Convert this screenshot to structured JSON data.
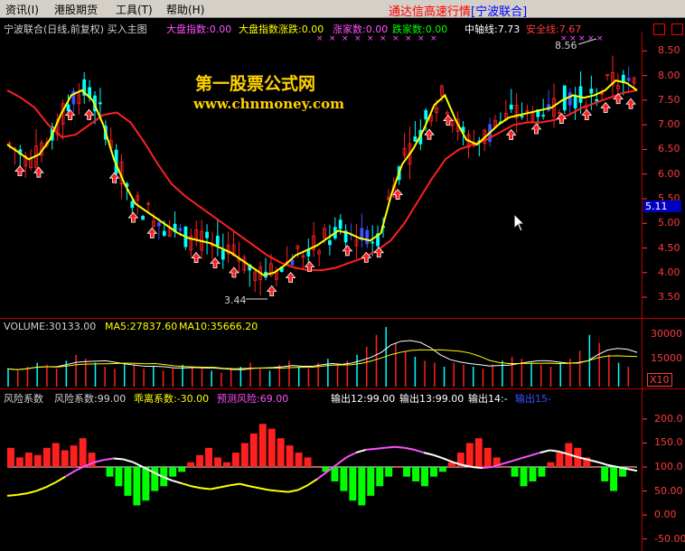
{
  "menu": {
    "items": [
      "资讯(I)",
      "港股期货",
      "工具(T)",
      "帮助(H)"
    ],
    "app_title": "通达信高速行情",
    "app_subtitle": "[宁波联合]"
  },
  "header": {
    "title": "宁波联合(日线,前复权) 买入主图",
    "dp_label": "大盘指数:0.00",
    "dpzd_label": "大盘指数涨跌:0.00",
    "zj_label": "涨家数:0.00",
    "dj_label": "跌家数:0.00",
    "zz_label": "中轴线:7.73",
    "aq_label": "安全线:7.67"
  },
  "watermark": {
    "line1": "第一股票公式网",
    "line2": "www.chnmoney.com"
  },
  "price_panel": {
    "high_label": "8.56",
    "low_label": "3.44",
    "current_price": "5.11",
    "ticks": [
      "8.50",
      "8.00",
      "7.50",
      "7.00",
      "6.50",
      "6.00",
      "5.50",
      "5.00",
      "4.50",
      "4.00",
      "3.50"
    ]
  },
  "volume_panel": {
    "label": "VOLUME:30133.00",
    "ma5_label": "MA5:27837.60",
    "ma10_label": "MA10:35666.20",
    "ticks": [
      "30000",
      "15000"
    ],
    "unit": "X10"
  },
  "risk_panel": {
    "title": "风险系数",
    "fx_label": "风险系数:99.00",
    "gl_label": "乖离系数:-30.00",
    "yc_label": "预测风险:69.00",
    "o12_label": "输出12:99.00",
    "o13_label": "输出13:99.00",
    "o14_label": "输出14:-",
    "o15_label": "输出15-",
    "ticks": [
      "200.0",
      "150.0",
      "100.0",
      "50.00",
      "0.00",
      "-50.00"
    ]
  },
  "colors": {
    "yellow": "#ffff00",
    "red": "#ff2020",
    "cyan": "#00ffff",
    "green": "#00ff00",
    "magenta": "#ff50ff",
    "white": "#ffffff",
    "axis_red": "#ff3b3b",
    "blue": "#3c50ff"
  },
  "chart_data": {
    "type": "line",
    "ylim": [
      3.3,
      8.8
    ],
    "ma_yellow": [
      6.6,
      6.45,
      6.3,
      6.4,
      6.7,
      7.2,
      7.6,
      7.7,
      7.5,
      7.0,
      6.3,
      5.8,
      5.4,
      5.25,
      5.1,
      4.95,
      4.8,
      4.7,
      4.65,
      4.6,
      4.5,
      4.4,
      4.25,
      4.1,
      3.95,
      4.0,
      4.15,
      4.35,
      4.45,
      4.55,
      4.7,
      4.85,
      4.8,
      4.7,
      4.65,
      4.8,
      5.6,
      6.2,
      6.5,
      6.9,
      7.4,
      7.6,
      7.1,
      6.7,
      6.6,
      6.8,
      7.0,
      7.15,
      7.2,
      7.25,
      7.3,
      7.35,
      7.5,
      7.6,
      7.55,
      7.6,
      7.7,
      7.9,
      7.85,
      7.7
    ],
    "ma_red": [
      7.7,
      7.55,
      7.35,
      7.0,
      6.75,
      6.8,
      7.0,
      7.2,
      7.25,
      7.05,
      6.65,
      6.2,
      5.8,
      5.55,
      5.35,
      5.15,
      4.95,
      4.75,
      4.55,
      4.35,
      4.2,
      4.1,
      4.05,
      4.05,
      4.1,
      4.2,
      4.3,
      4.45,
      4.65,
      5.0,
      5.45,
      5.9,
      6.3,
      6.5,
      6.6,
      6.7,
      6.85,
      7.0,
      7.05,
      7.05,
      7.1,
      7.2,
      7.35,
      7.45,
      7.55,
      7.65,
      7.7
    ],
    "volume": [
      9,
      8,
      10,
      12,
      11,
      9,
      13,
      16,
      14,
      12,
      10,
      9,
      12,
      11,
      9,
      10,
      8,
      9,
      11,
      10,
      9,
      8,
      7,
      9,
      10,
      12,
      9,
      8,
      11,
      13,
      10,
      9,
      12,
      14,
      11,
      13,
      16,
      20,
      26,
      30,
      22,
      18,
      15,
      13,
      12,
      10,
      12,
      11,
      10,
      9,
      11,
      13,
      15,
      14,
      12,
      11,
      10,
      12,
      14,
      18,
      26,
      22,
      16,
      12,
      10
    ],
    "risk_bars": [
      40,
      20,
      30,
      25,
      40,
      50,
      35,
      45,
      60,
      30,
      0,
      -20,
      -40,
      -60,
      -80,
      -70,
      -50,
      -40,
      -20,
      -10,
      10,
      25,
      40,
      20,
      10,
      30,
      50,
      70,
      90,
      80,
      60,
      45,
      30,
      20,
      0,
      -10,
      -30,
      -50,
      -70,
      -80,
      -60,
      -40,
      -20,
      0,
      -20,
      -30,
      -40,
      -20,
      -10,
      10,
      30,
      50,
      60,
      40,
      20,
      0,
      -20,
      -40,
      -30,
      -20,
      10,
      30,
      50,
      40,
      20,
      0,
      -30,
      -50,
      -20,
      0
    ],
    "risk_line": [
      40,
      42,
      45,
      50,
      58,
      68,
      80,
      92,
      102,
      110,
      115,
      118,
      116,
      110,
      100,
      90,
      80,
      72,
      66,
      60,
      56,
      54,
      58,
      62,
      65,
      60,
      56,
      52,
      50,
      48,
      52,
      62,
      75,
      90,
      105,
      120,
      130,
      136,
      138,
      140,
      142,
      140,
      136,
      130,
      125,
      118,
      110,
      104,
      100,
      98,
      100,
      106,
      112,
      118,
      124,
      130,
      135,
      132,
      126,
      120,
      115,
      110,
      104,
      100,
      96,
      92
    ]
  }
}
